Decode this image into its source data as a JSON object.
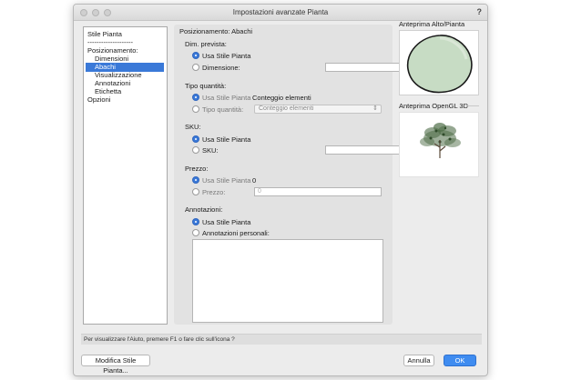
{
  "window": {
    "title": "Impostazioni avanzate Pianta",
    "help": "?"
  },
  "nav": {
    "items": [
      {
        "label": "Stile Pianta"
      },
      {
        "label": "--------------------"
      },
      {
        "label": "Posizionamento:"
      },
      {
        "label": "Dimensioni"
      },
      {
        "label": "Abachi",
        "selected": true
      },
      {
        "label": "Visualizzazione"
      },
      {
        "label": "Annotazioni"
      },
      {
        "label": "Etichetta"
      },
      {
        "label": "Opzioni"
      }
    ]
  },
  "panel": {
    "title": "Posizionamento: Abachi",
    "dim": {
      "label": "Dim. prevista:",
      "opt1": "Usa Stile Pianta",
      "opt2": "Dimensione:",
      "value": ""
    },
    "tipo": {
      "label": "Tipo quantità:",
      "opt1": "Usa Stile Pianta",
      "opt1_value": "Conteggio elementi",
      "opt2": "Tipo quantità:",
      "select_value": "Conteggio elementi"
    },
    "sku": {
      "label": "SKU:",
      "opt1": "Usa Stile Pianta",
      "opt2": "SKU:",
      "value": ""
    },
    "prezzo": {
      "label": "Prezzo:",
      "opt1": "Usa Stile Pianta",
      "opt1_value": "0",
      "opt2": "Prezzo:",
      "value": "0"
    },
    "annot": {
      "label": "Annotazioni:",
      "opt1": "Usa Stile Pianta",
      "opt2": "Annotazioni personali:",
      "value": ""
    }
  },
  "preview": {
    "top_label": "Anteprima Alto/Pianta",
    "opengl_label": "Anteprima OpenGL 3D"
  },
  "helpbar": "Per visualizzare l'Aiuto, premere F1 o fare clic sull'icona ?",
  "buttons": {
    "modify": "Modifica Stile Pianta...",
    "cancel": "Annulla",
    "ok": "OK"
  },
  "colors": {
    "accent": "#3a79d8",
    "plant_fill": "#c7dcc4"
  }
}
